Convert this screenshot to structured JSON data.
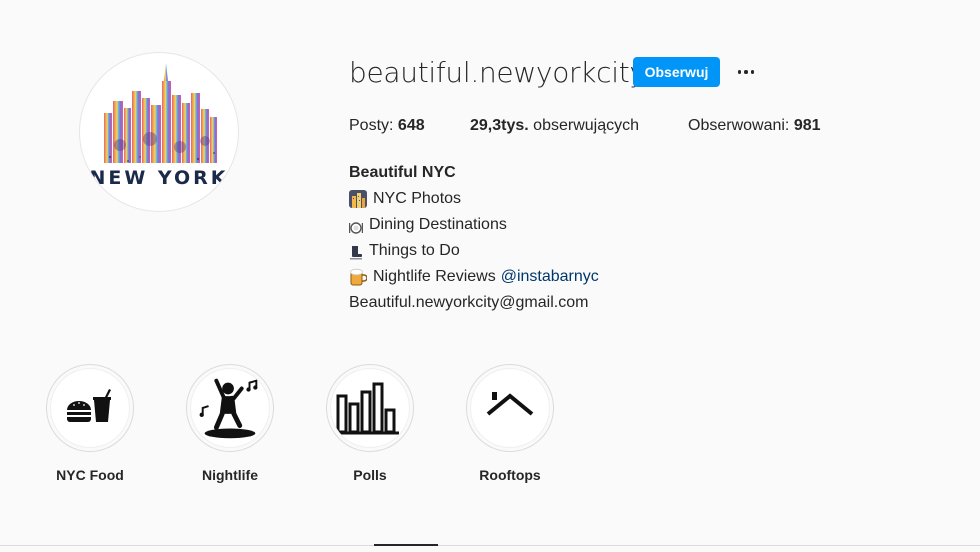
{
  "profile": {
    "username": "beautiful.newyorkcity",
    "follow_label": "Obserwuj",
    "more_icon": "more-horizontal-icon",
    "avatar_text": "NEW YORK"
  },
  "stats": {
    "posts_label": "Posty:",
    "posts_value": "648",
    "followers_value": "29,3tys.",
    "followers_label": "obserwujących",
    "following_label": "Obserwowani:",
    "following_value": "981"
  },
  "bio": {
    "name": "Beautiful NYC",
    "lines": [
      {
        "icon": "city-icon",
        "text": "NYC Photos"
      },
      {
        "icon": "plate-icon",
        "text": "Dining Destinations"
      },
      {
        "icon": "skate-icon",
        "text": "Things to Do"
      },
      {
        "icon": "beer-icon",
        "text": "Nightlife Reviews",
        "mention": "@instabarnyc"
      }
    ],
    "email": "Beautiful.newyorkcity@gmail.com"
  },
  "highlights": [
    {
      "label": "NYC Food",
      "icon": "burger-drink-icon"
    },
    {
      "label": "Nightlife",
      "icon": "dancer-icon"
    },
    {
      "label": "Polls",
      "icon": "bar-chart-icon"
    },
    {
      "label": "Rooftops",
      "icon": "rooftop-icon"
    }
  ],
  "colors": {
    "accent": "#0095f6",
    "text": "#262626",
    "link": "#00376b",
    "background": "#fafafa"
  }
}
